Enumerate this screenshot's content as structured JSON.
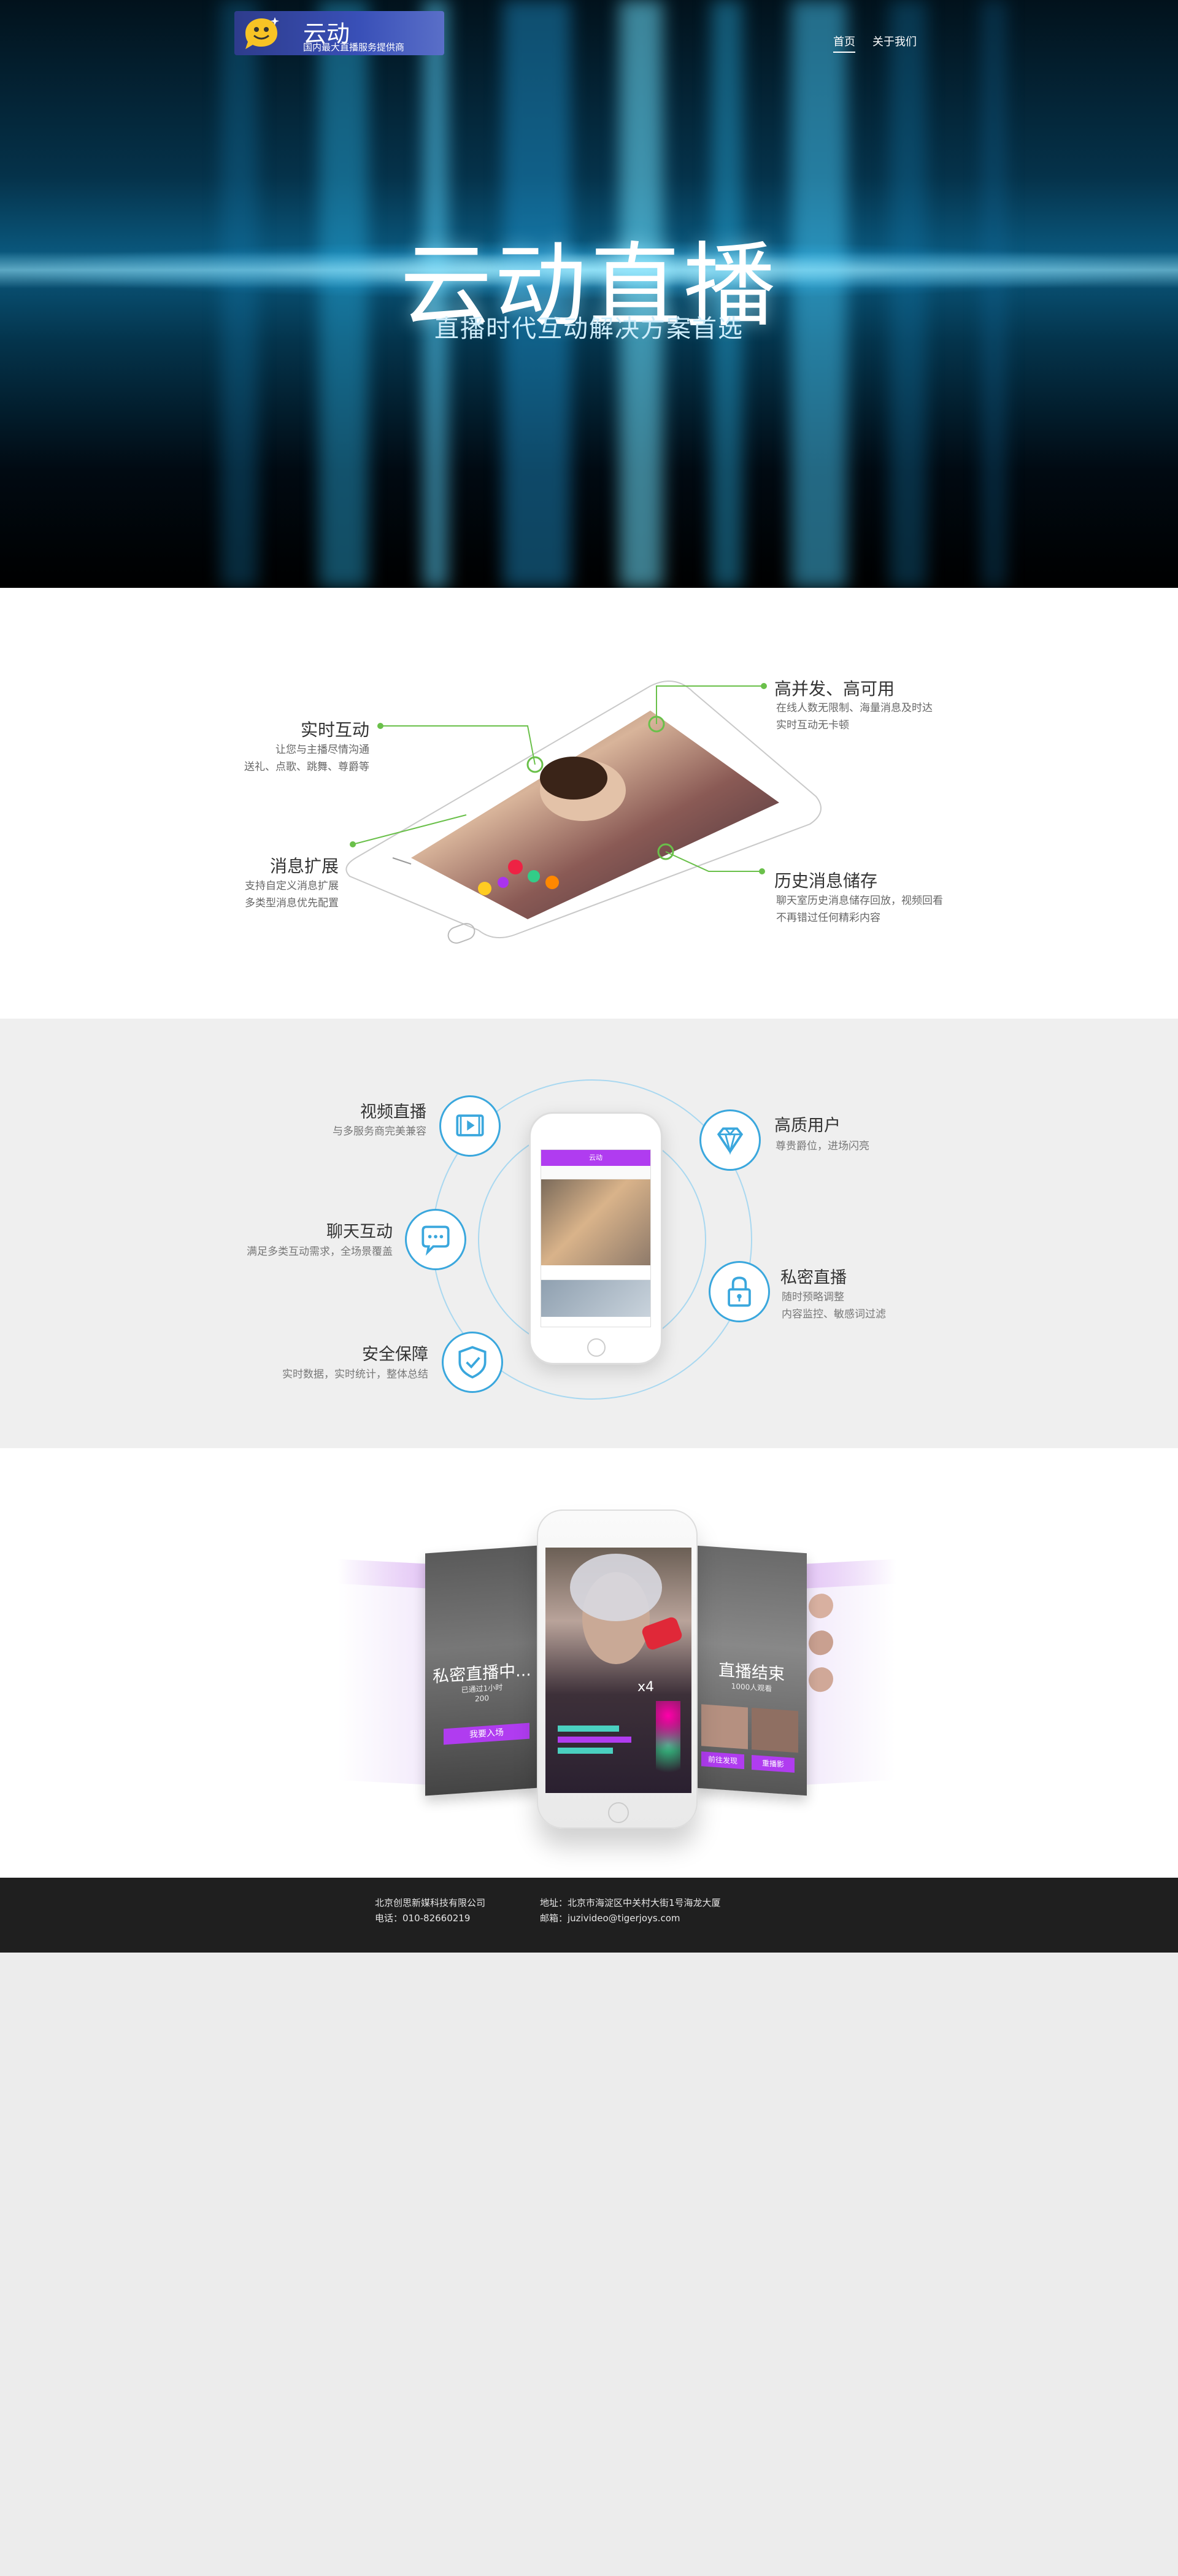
{
  "logo": {
    "title": "云动",
    "subtitle": "国内最大直播服务提供商"
  },
  "nav": {
    "home": "首页",
    "about": "关于我们"
  },
  "hero": {
    "title": "云动直播",
    "subtitle": "直播时代互动解决方案首选"
  },
  "section2": {
    "realtime": {
      "title": "实时互动",
      "lines": [
        "让您与主播尽情沟通",
        "送礼、点歌、跳舞、尊爵等"
      ]
    },
    "concurrency": {
      "title": "高并发、高可用",
      "lines": [
        "在线人数无限制、海量消息及时达",
        "实时互动无卡顿"
      ]
    },
    "extension": {
      "title": "消息扩展",
      "lines": [
        "支持自定义消息扩展",
        "多类型消息优先配置"
      ]
    },
    "history": {
      "title": "历史消息储存",
      "lines": [
        "聊天室历史消息储存回放，视频回看",
        "不再错过任何精彩内容"
      ]
    }
  },
  "section3": {
    "video": {
      "title": "视频直播",
      "desc": "与多服务商完美兼容"
    },
    "chat": {
      "title": "聊天互动",
      "desc": "满足多类互动需求，全场景覆盖"
    },
    "security": {
      "title": "安全保障",
      "desc": "实时数据，实时统计，整体总结"
    },
    "quality": {
      "title": "高质用户",
      "desc": "尊贵爵位，进场闪亮"
    },
    "private": {
      "title": "私密直播",
      "lines": [
        "随时预略调整",
        "内容监控、敏感词过滤"
      ]
    },
    "phone_title": "云动"
  },
  "section4": {
    "left_screen": {
      "title": "私密直播中...",
      "sub1": "已通过1小时",
      "sub2": "200",
      "button": "我要入场"
    },
    "right_screen": {
      "title": "直播结束",
      "sub": "1000人观看",
      "button_left": "前往发现",
      "button_right": "重播影"
    },
    "center_overlay": "x4"
  },
  "footer": {
    "company": "北京创思新媒科技有限公司",
    "phone": "电话：010-82660219",
    "address": "地址：北京市海淀区中关村大街1号海龙大厦",
    "email": "邮箱：juzivideo@tigerjoys.com"
  },
  "colors": {
    "accent_blue": "#3aa7dd",
    "accent_purple": "#b03cf0",
    "green_line": "#6ac04a",
    "footer_bg": "#1f1f1f"
  }
}
